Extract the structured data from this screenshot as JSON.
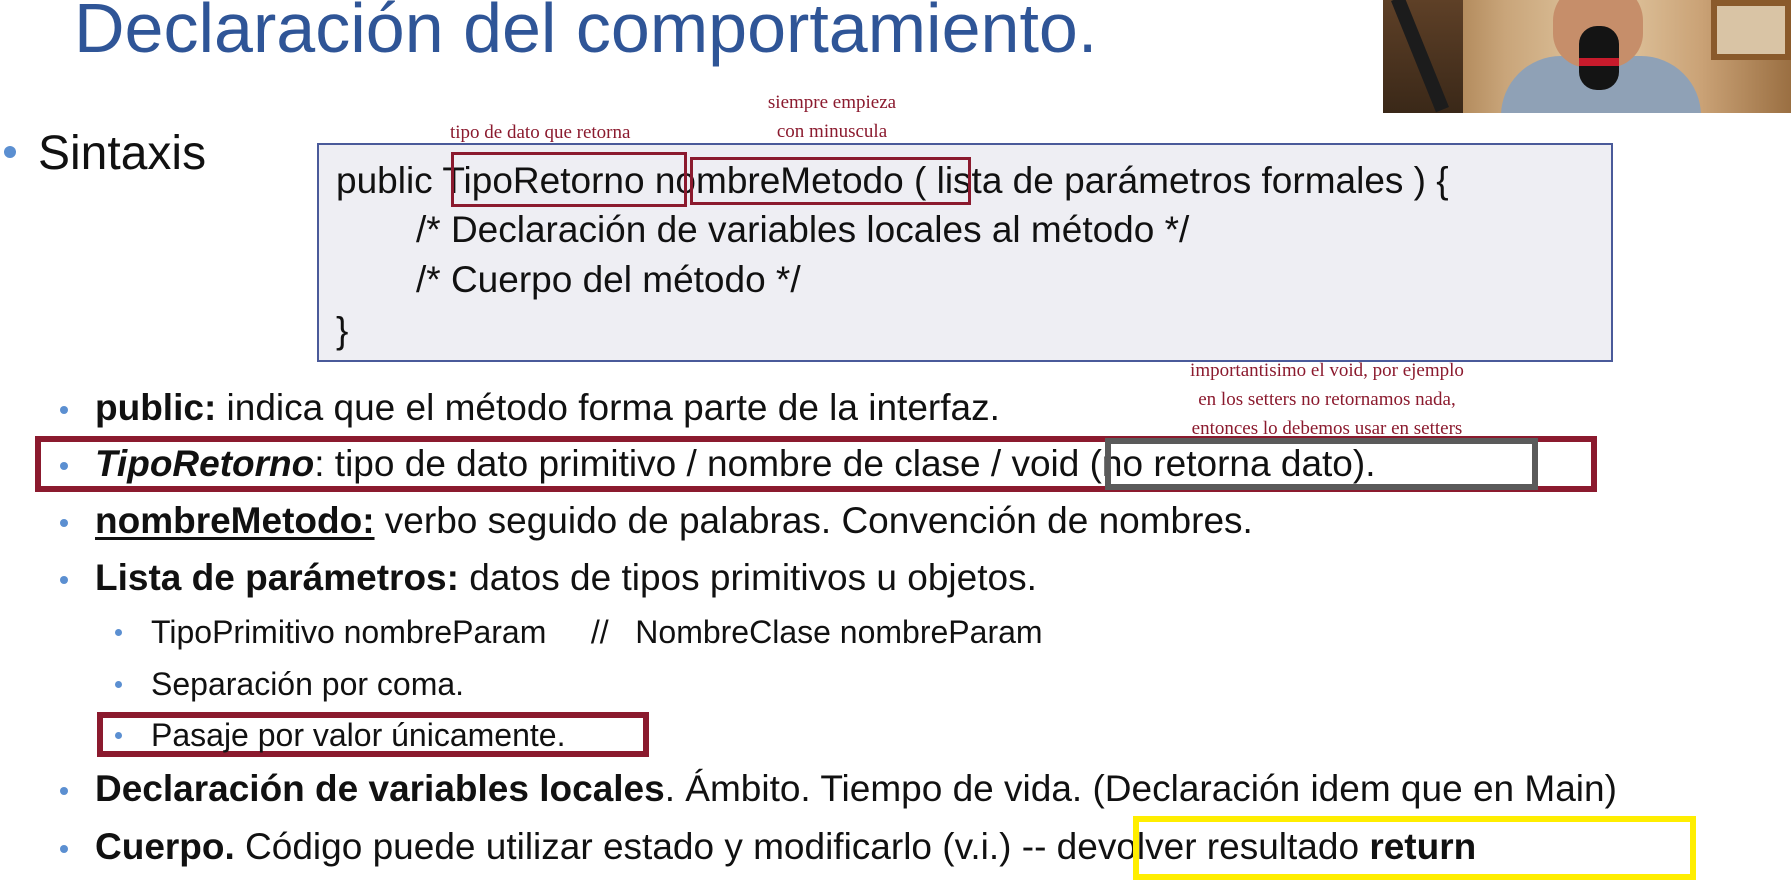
{
  "slide": {
    "title": "Declaración del comportamiento.",
    "sintaxis": "Sintaxis"
  },
  "annotations": {
    "tipo_retorno": "tipo de dato que retorna",
    "siempre_1": "siempre empieza",
    "siempre_2": "con minuscula",
    "void_1": "importantisimo el void, por ejemplo",
    "void_2": "en los setters no retornamos nada,",
    "void_3": "entonces lo debemos usar en setters"
  },
  "code": {
    "public": "public",
    "tipo": "TipoRetorno",
    "nombre": "nombreMetodo",
    "rest": "( lista de parámetros formales ) {",
    "line2": "/* Declaración de variables locales al método */",
    "line3": "/* Cuerpo del método */",
    "line4": "}"
  },
  "bullets": {
    "public_term": "public:",
    "public_text": " indica que el método forma parte de la interfaz.",
    "tipo_term": "TipoRetorno",
    "tipo_text": ": tipo de dato primitivo / nombre de clase / ",
    "tipo_void": "void (no retorna dato).",
    "nombre_term": "nombreMetodo:",
    "nombre_text": " verbo seguido de palabras. Convención de nombres.",
    "lista_term": "Lista de parámetros:",
    "lista_text": " datos de tipos primitivos u objetos.",
    "sub1": "TipoPrimitivo nombreParam     //   NombreClase nombreParam",
    "sub2": "Separación por coma.",
    "sub3": "Pasaje por valor únicamente.",
    "decl_term": "Declaración de variables locales",
    "decl_text": ". Ámbito. Tiempo de vida. (Declaración idem que en Main)",
    "cuerpo_term": "Cuerpo.",
    "cuerpo_text": " Código puede utilizar estado y modificarlo (v.i.) ",
    "cuerpo_dash": "-",
    "cuerpo_dash2": "- devolver resultado ",
    "cuerpo_return": "return"
  }
}
